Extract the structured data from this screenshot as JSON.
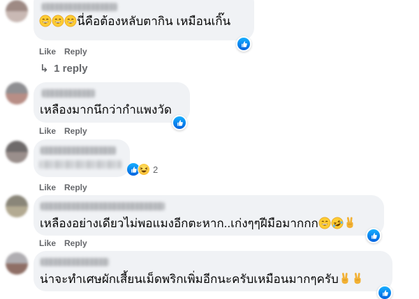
{
  "actions": {
    "like": "Like",
    "reply": "Reply"
  },
  "comments": [
    {
      "text": "นี่คือต้องหลับตากิน เหมือนเกิ๊น",
      "reply_toggle": "1 reply"
    },
    {
      "text": "เหลืองมากนึกว่ากำแพงวัด"
    },
    {
      "reaction_count": "2"
    },
    {
      "text": "เหลืองอย่างเดียวไม่พอแมงอีกตะหาก..เก่งๆๆฝีมือมากกก"
    },
    {
      "text": "น่าจะทำเศษผักเสี้ยนเม็ดพริกเพิ่มอีกนะครับเหมือนมากๆครับ"
    }
  ],
  "colors": {
    "like_blue": "#1877f2",
    "bubble_gray": "#f0f2f5",
    "meta_gray": "#65676b"
  },
  "icons": [
    "reply-arrow-icon",
    "like-reaction-icon",
    "haha-reaction-icon",
    "grin-emoji-icon",
    "rofl-emoji-icon",
    "victory-hand-emoji-icon"
  ]
}
